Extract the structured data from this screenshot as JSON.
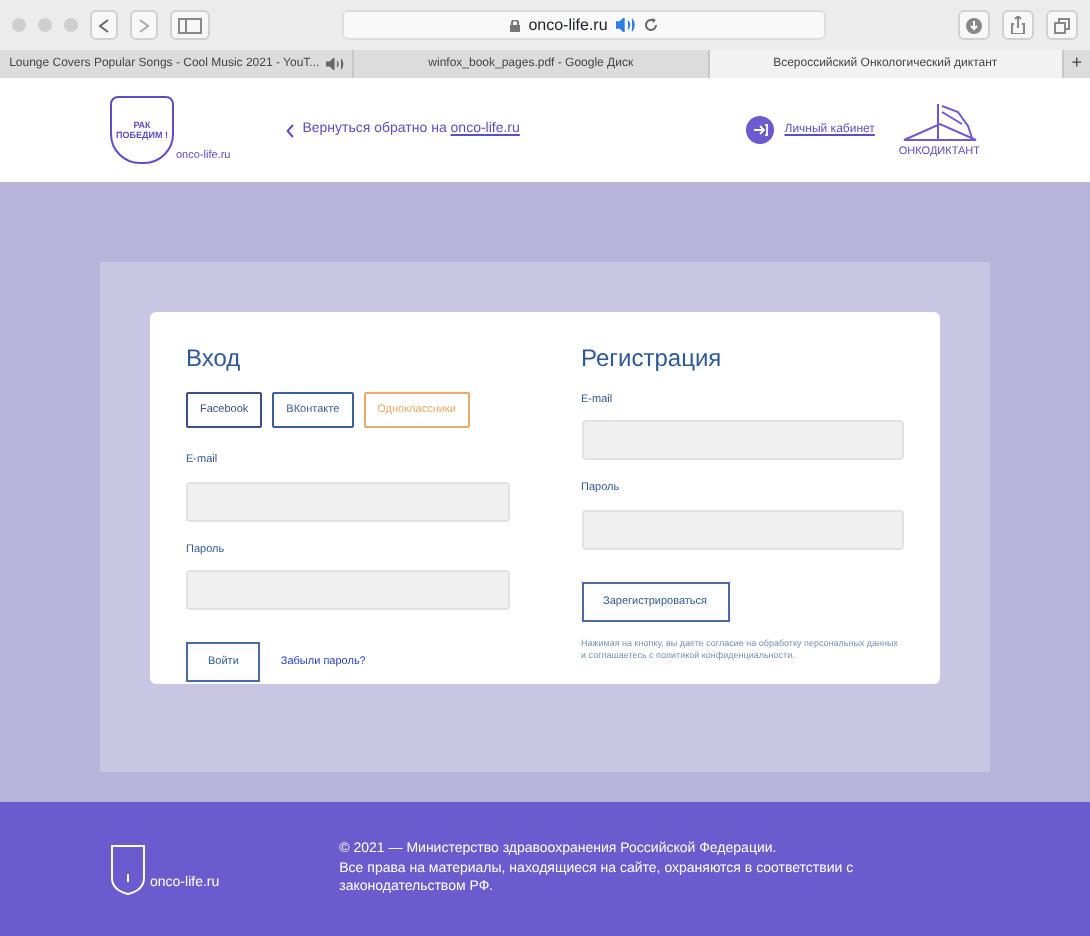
{
  "browser": {
    "address": "onco-life.ru",
    "tabs": [
      {
        "title": "Lounge Covers Popular Songs - Cool Music 2021 - YouT...",
        "audio": true,
        "selected": false
      },
      {
        "title": "winfox_book_pages.pdf - Google Диск",
        "audio": false,
        "selected": false
      },
      {
        "title": "Всероссийский Онкологический диктант",
        "audio": false,
        "selected": true
      }
    ],
    "new_tab": "+"
  },
  "header": {
    "logo_text": "РАК ПОБЕДИМ !",
    "logo_site": "onco-life.ru",
    "back_text": "Вернуться обратно на ",
    "back_link": "onco-life.ru",
    "account_link": "Личный кабинет",
    "brand": "ОНКОДИКТАНТ"
  },
  "login": {
    "title": "Вход",
    "social": [
      {
        "label": "Facebook",
        "color": "#3b4f8c"
      },
      {
        "label": "ВКонтакте",
        "color": "#3b5f9c"
      },
      {
        "label": "Одноклассники",
        "color": "#f0a868"
      }
    ],
    "fields": [
      {
        "label": "E-mail"
      },
      {
        "label": "Пароль"
      }
    ],
    "submit": "Войти",
    "forgot": "Забыли пароль?"
  },
  "register": {
    "title": "Регистрация",
    "fields": [
      {
        "label": "E-mail"
      },
      {
        "label": "Пароль"
      }
    ],
    "submit": "Зарегистрироваться",
    "note": "Нажимая на кнопку, вы даете согласие на обработку персональных данных и соглашаетесь с политикой конфиденциальности."
  },
  "footer": {
    "logo_site": "onco-life.ru",
    "lines": [
      "© 2021 — Министерство здравоохранения Российской Федерации.",
      "Все права на материалы, находящиеся на сайте, охраняются в соответствии с законодательством РФ."
    ]
  }
}
